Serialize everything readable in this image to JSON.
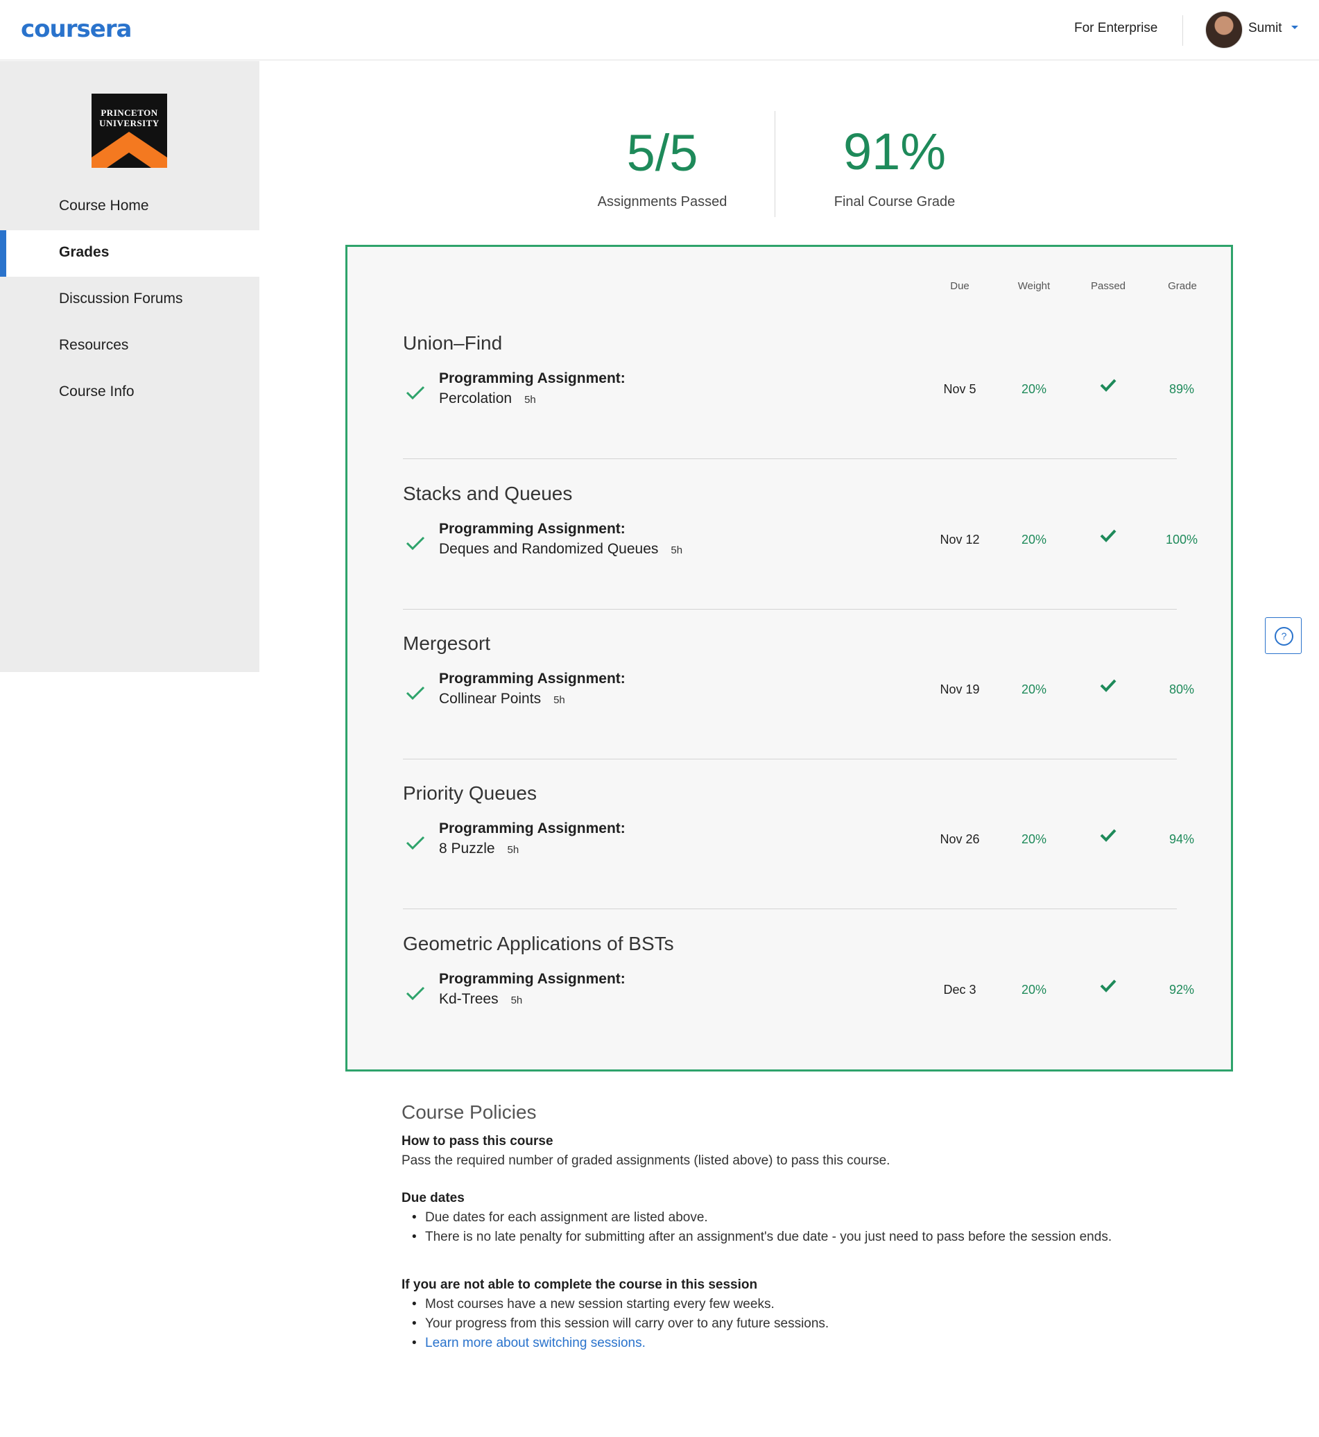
{
  "header": {
    "logo": "coursera",
    "enterprise_link": "For Enterprise",
    "username": "Sumit"
  },
  "sidebar": {
    "university_logo_text": "PRINCETON UNIVERSITY",
    "items": [
      {
        "label": "Course Home"
      },
      {
        "label": "Grades",
        "active": true
      },
      {
        "label": "Discussion Forums"
      },
      {
        "label": "Resources"
      },
      {
        "label": "Course Info"
      }
    ]
  },
  "summary": {
    "assignments_value": "5/5",
    "assignments_label": "Assignments Passed",
    "grade_value": "91%",
    "grade_label": "Final Course Grade"
  },
  "grades_table": {
    "columns": {
      "due": "Due",
      "weight": "Weight",
      "passed": "Passed",
      "grade": "Grade"
    },
    "modules": [
      {
        "title": "Union–Find",
        "item_type": "Programming Assignment:",
        "item_name": "Percolation",
        "duration": "5h",
        "due": "Nov 5",
        "weight": "20%",
        "passed": true,
        "grade": "89%"
      },
      {
        "title": "Stacks and Queues",
        "item_type": "Programming Assignment:",
        "item_name": "Deques and Randomized Queues",
        "duration": "5h",
        "due": "Nov 12",
        "weight": "20%",
        "passed": true,
        "grade": "100%"
      },
      {
        "title": "Mergesort",
        "item_type": "Programming Assignment:",
        "item_name": "Collinear Points",
        "duration": "5h",
        "due": "Nov 19",
        "weight": "20%",
        "passed": true,
        "grade": "80%"
      },
      {
        "title": "Priority Queues",
        "item_type": "Programming Assignment:",
        "item_name": "8 Puzzle",
        "duration": "5h",
        "due": "Nov 26",
        "weight": "20%",
        "passed": true,
        "grade": "94%"
      },
      {
        "title": "Geometric Applications of BSTs",
        "item_type": "Programming Assignment:",
        "item_name": "Kd-Trees",
        "duration": "5h",
        "due": "Dec 3",
        "weight": "20%",
        "passed": true,
        "grade": "92%"
      }
    ]
  },
  "help_button": {
    "icon": "?"
  },
  "policies": {
    "title": "Course Policies",
    "pass_heading": "How to pass this course",
    "pass_text": "Pass the required number of graded assignments (listed above) to pass this course.",
    "due_heading": "Due dates",
    "due_items": [
      "Due dates for each assignment are listed above.",
      "There is no late penalty for submitting after an assignment's due date - you just need to pass before the session ends."
    ],
    "session_heading": "If you are not able to complete the course in this session",
    "session_items": [
      "Most courses have a new session starting every few weeks.",
      "Your progress from this session will carry over to any future sessions."
    ],
    "session_link": "Learn more about switching sessions."
  },
  "colors": {
    "brand_blue": "#2a73cc",
    "success_green": "#1e8a5a",
    "panel_border": "#2ea36b"
  }
}
